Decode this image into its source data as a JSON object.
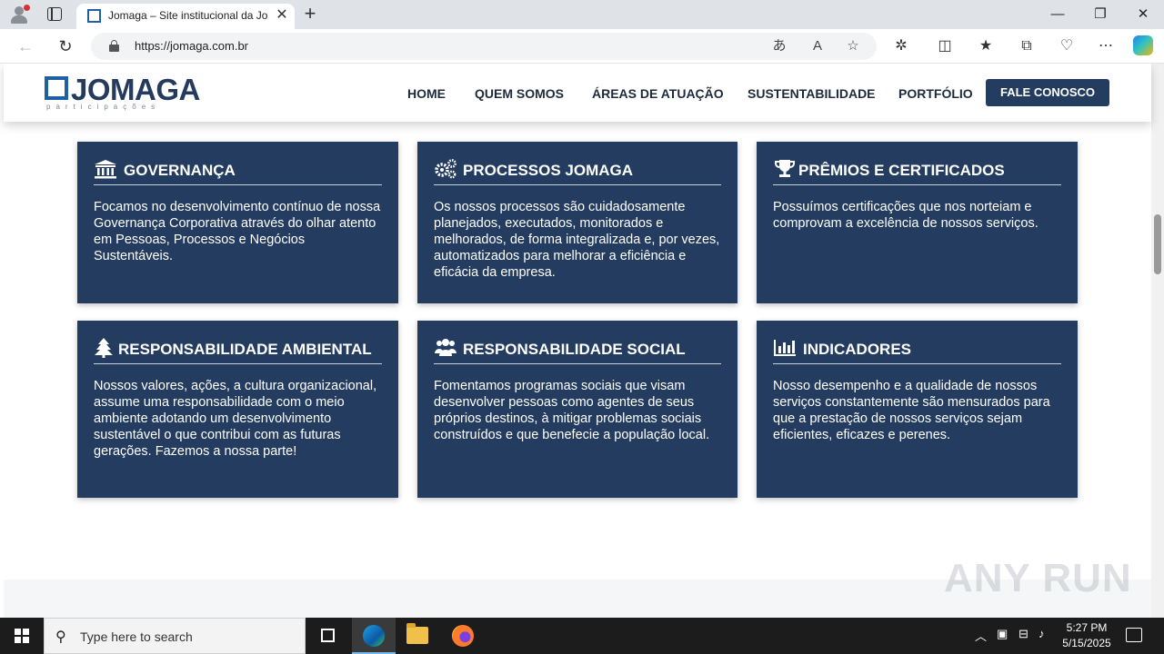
{
  "browser": {
    "tab_title": "Jomaga – Site institucional da Jomaga",
    "url": "https://jomaga.com.br",
    "tab_close_glyph": "✕",
    "new_tab_glyph": "+",
    "window_controls": {
      "minimize": "—",
      "maximize": "❐",
      "close": "✕"
    }
  },
  "site": {
    "logo": {
      "word": "JOMAGA",
      "subtitle": "participações"
    },
    "nav": {
      "home": "HOME",
      "quem_somos": "QUEM SOMOS",
      "areas": "ÁREAS DE ATUAÇÃO",
      "sustentabilidade": "SUSTENTABILIDADE",
      "portfolio": "PORTFÓLIO",
      "cta": "FALE CONOSCO"
    },
    "cards": [
      {
        "icon": "bank-icon",
        "title": "GOVERNANÇA",
        "text": "Focamos no desenvolvimento contínuo de nossa Governança Corporativa através do olhar atento em Pessoas, Processos e Negócios Sustentáveis."
      },
      {
        "icon": "gears-icon",
        "title": "PROCESSOS JOMAGA",
        "text": "Os nossos processos são cuidadosamente planejados, executados, monitorados e melhorados, de forma integralizada e, por vezes, automatizados para melhorar a eficiência e eficácia da empresa."
      },
      {
        "icon": "trophy-icon",
        "title": "PRÊMIOS E CERTIFICADOS",
        "text": "Possuímos certificações que nos norteiam e comprovam a excelência de nossos serviços."
      },
      {
        "icon": "tree-icon",
        "title": "RESPONSABILIDADE AMBIENTAL",
        "text": "Nossos valores, ações, a cultura organizacional, assume uma responsabilidade com o meio ambiente adotando um desenvolvimento sustentável o que contribui com as futuras gerações. Fazemos a nossa parte!"
      },
      {
        "icon": "users-icon",
        "title": "RESPONSABILIDADE SOCIAL",
        "text": "Fomentamos programas sociais que visam desenvolver pessoas como agentes de seus próprios destinos, à mitigar problemas sociais construídos e que benefecie a população local."
      },
      {
        "icon": "bar-chart-icon",
        "title": "INDICADORES",
        "text": "Nosso desempenho e a qualidade de nossos serviços constantemente são mensurados para que a prestação de nossos serviços sejam eficientes, eficazes e perenes."
      }
    ],
    "colors": {
      "primary": "#233c5f",
      "accent": "#1f5fa6"
    }
  },
  "watermark": "ANY RUN",
  "taskbar": {
    "search_placeholder": "Type here to search",
    "time": "5:27 PM",
    "date": "5/15/2025"
  }
}
